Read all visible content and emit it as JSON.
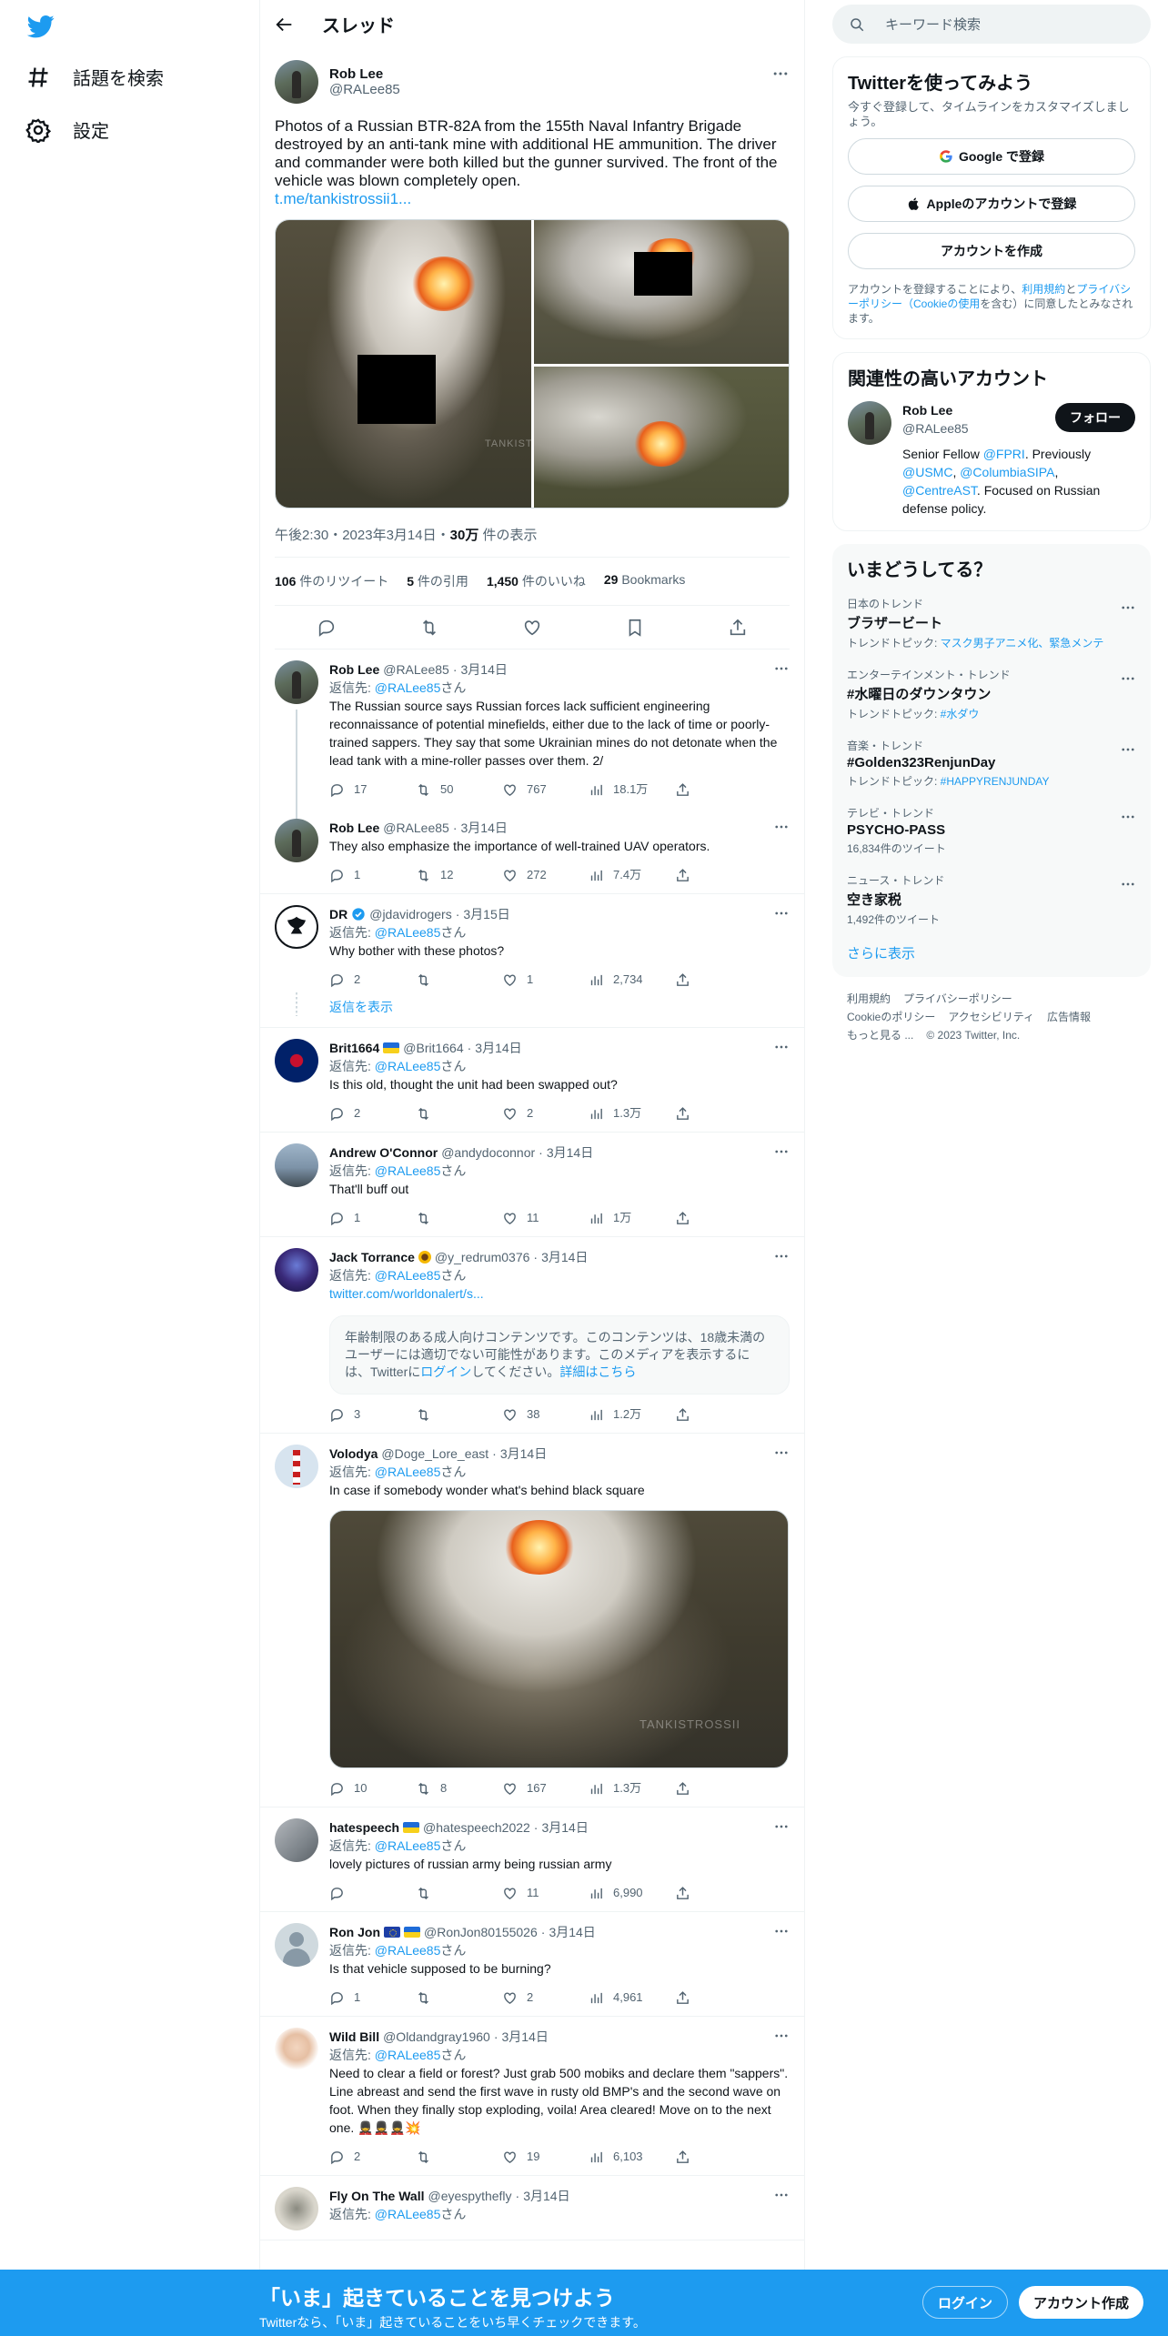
{
  "nav": {
    "explore": "話題を検索",
    "settings": "設定"
  },
  "header": {
    "title": "スレッド"
  },
  "main_tweet": {
    "name": "Rob Lee",
    "handle": "@RALee85",
    "text": "Photos of a Russian BTR-82A from the 155th Naval Infantry Brigade destroyed by an anti-tank mine with additional HE ammunition. The driver and commander were both killed but the gunner survived. The front of the vehicle was blown completely open.",
    "link": "t.me/tankistrossii1...",
    "time": "午後2:30",
    "date": "2023年3月14日",
    "views": "30万",
    "views_suffix": " 件の表示",
    "retweets": "106",
    "retweets_label": " 件のリツイート",
    "quotes": "5",
    "quotes_label": " 件の引用",
    "likes": "1,450",
    "likes_label": " 件のいいね",
    "bookmarks": "29",
    "bookmarks_label": " Bookmarks"
  },
  "replies": [
    {
      "name": "Rob Lee",
      "handle": "@RALee85",
      "date": "3月14日",
      "replyto_prefix": "返信先: ",
      "replyto": "@RALee85",
      "replyto_suffix": "さん",
      "text": "The Russian source says Russian forces lack sufficient engineering reconnaissance of potential minefields, either due to the lack of time or poorly-trained sappers. They say that some Ukrainian mines do not detonate when the lead tank with a mine-roller passes over them. 2/",
      "replies": "17",
      "retweets": "50",
      "likes": "767",
      "views": "18.1万"
    },
    {
      "name": "Rob Lee",
      "handle": "@RALee85",
      "date": "3月14日",
      "text": "They also emphasize the importance of well-trained UAV operators.",
      "replies": "1",
      "retweets": "12",
      "likes": "272",
      "views": "7.4万"
    },
    {
      "name": "DR",
      "handle": "@jdavidrogers",
      "date": "3月15日",
      "replyto_prefix": "返信先: ",
      "replyto": "@RALee85",
      "replyto_suffix": "さん",
      "text": "Why bother with these photos?",
      "replies": "2",
      "retweets": "",
      "likes": "1",
      "views": "2,734",
      "show_replies": "返信を表示"
    },
    {
      "name": "Brit1664",
      "handle": "@Brit1664",
      "date": "3月14日",
      "replyto_prefix": "返信先: ",
      "replyto": "@RALee85",
      "replyto_suffix": "さん",
      "text": "Is this old, thought the unit had been swapped out?",
      "replies": "2",
      "retweets": "",
      "likes": "2",
      "views": "1.3万"
    },
    {
      "name": "Andrew O'Connor",
      "handle": "@andydoconnor",
      "date": "3月14日",
      "replyto_prefix": "返信先: ",
      "replyto": "@RALee85",
      "replyto_suffix": "さん",
      "text": "That'll buff out",
      "replies": "1",
      "retweets": "",
      "likes": "11",
      "views": "1万"
    },
    {
      "name": "Jack Torrance",
      "handle": "@y_redrum0376",
      "date": "3月14日",
      "replyto_prefix": "返信先: ",
      "replyto": "@RALee85",
      "replyto_suffix": "さん",
      "link": "twitter.com/worldonalert/s...",
      "sensitive_text": "年齢制限のある成人向けコンテンツです。このコンテンツは、18歳未満のユーザーには適切でない可能性があります。このメディアを表示するには、Twitterに",
      "sensitive_login": "ログイン",
      "sensitive_mid": "してください。",
      "sensitive_more": "詳細はこちら",
      "replies": "3",
      "retweets": "",
      "likes": "38",
      "views": "1.2万"
    },
    {
      "name": "Volodya",
      "handle": "@Doge_Lore_east",
      "date": "3月14日",
      "replyto_prefix": "返信先: ",
      "replyto": "@RALee85",
      "replyto_suffix": "さん",
      "text": "In case if somebody wonder what's behind black square",
      "replies": "10",
      "retweets": "8",
      "likes": "167",
      "views": "1.3万"
    },
    {
      "name": "hatespeech",
      "handle": "@hatespeech2022",
      "date": "3月14日",
      "replyto_prefix": "返信先: ",
      "replyto": "@RALee85",
      "replyto_suffix": "さん",
      "text": "lovely pictures of russian army being russian army",
      "replies": "",
      "retweets": "",
      "likes": "11",
      "views": "6,990"
    },
    {
      "name": "Ron Jon",
      "handle": "@RonJon80155026",
      "date": "3月14日",
      "replyto_prefix": "返信先: ",
      "replyto": "@RALee85",
      "replyto_suffix": "さん",
      "text": "Is that vehicle supposed to be burning?",
      "replies": "1",
      "retweets": "",
      "likes": "2",
      "views": "4,961"
    },
    {
      "name": "Wild Bill",
      "handle": "@Oldandgray1960",
      "date": "3月14日",
      "replyto_prefix": "返信先: ",
      "replyto": "@RALee85",
      "replyto_suffix": "さん",
      "text": "Need to clear a field or forest? Just grab 500 mobiks and declare them \"sappers\". Line abreast and send the first wave in rusty old BMP's and the second wave on foot. When they finally stop exploding, voila! Area cleared! Move on to the next one. 💂💂💂💥",
      "replies": "2",
      "retweets": "",
      "likes": "19",
      "views": "6,103"
    },
    {
      "name": "Fly On The Wall",
      "handle": "@eyespythefly",
      "date": "3月14日",
      "replyto_prefix": "返信先: ",
      "replyto": "@RALee85",
      "replyto_suffix": "さん"
    }
  ],
  "search": {
    "placeholder": "キーワード検索"
  },
  "signup_card": {
    "title": "Twitterを使ってみよう",
    "sub": "今すぐ登録して、タイムラインをカスタマイズしましょう。",
    "google": "Google で登録",
    "apple": "Appleのアカウントで登録",
    "create": "アカウントを作成",
    "terms_1": "アカウントを登録することにより、",
    "terms_link1": "利用規約",
    "terms_2": "と",
    "terms_link2": "プライバシーポリシー（Cookieの使用",
    "terms_3": "を含む）に同意したとみなされます。"
  },
  "related": {
    "title": "関連性の高いアカウント",
    "name": "Rob Lee",
    "handle": "@RALee85",
    "follow": "フォロー",
    "bio_1": "Senior Fellow ",
    "bio_m1": "@FPRI",
    "bio_2": ". Previously ",
    "bio_m2": "@USMC",
    "bio_3": ", ",
    "bio_m3": "@ColumbiaSIPA",
    "bio_4": ", ",
    "bio_m4": "@CentreAST",
    "bio_5": ". Focused on Russian defense policy."
  },
  "trends": {
    "title": "いまどうしてる？",
    "items": [
      {
        "cat": "日本のトレンド",
        "name": "ブラザービート",
        "meta_label": "トレンドトピック: ",
        "meta_link": "マスク男子アニメ化、緊急メンテ"
      },
      {
        "cat": "エンターテインメント・トレンド",
        "name": "#水曜日のダウンタウン",
        "meta_label": "トレンドトピック: ",
        "meta_link": "#水ダウ"
      },
      {
        "cat": "音楽・トレンド",
        "name": "#Golden323RenjunDay",
        "meta_label": "トレンドトピック: ",
        "meta_link": "#HAPPYRENJUNDAY"
      },
      {
        "cat": "テレビ・トレンド",
        "name": "PSYCHO-PASS",
        "meta": "16,834件のツイート"
      },
      {
        "cat": "ニュース・トレンド",
        "name": "空き家税",
        "meta": "1,492件のツイート"
      }
    ],
    "show_more": "さらに表示"
  },
  "footer": {
    "terms": "利用規約",
    "privacy": "プライバシーポリシー",
    "cookie": "Cookieのポリシー",
    "access": "アクセシビリティ",
    "ads": "広告情報",
    "more": "もっと見る ...",
    "copyright": "© 2023 Twitter, Inc."
  },
  "bottom": {
    "title": "「いま」起きていることを見つけよう",
    "sub": "Twitterなら、「いま」起きていることをいち早くチェックできます。",
    "login": "ログイン",
    "signup": "アカウント作成"
  },
  "watermark": "TANKISTROSSII"
}
